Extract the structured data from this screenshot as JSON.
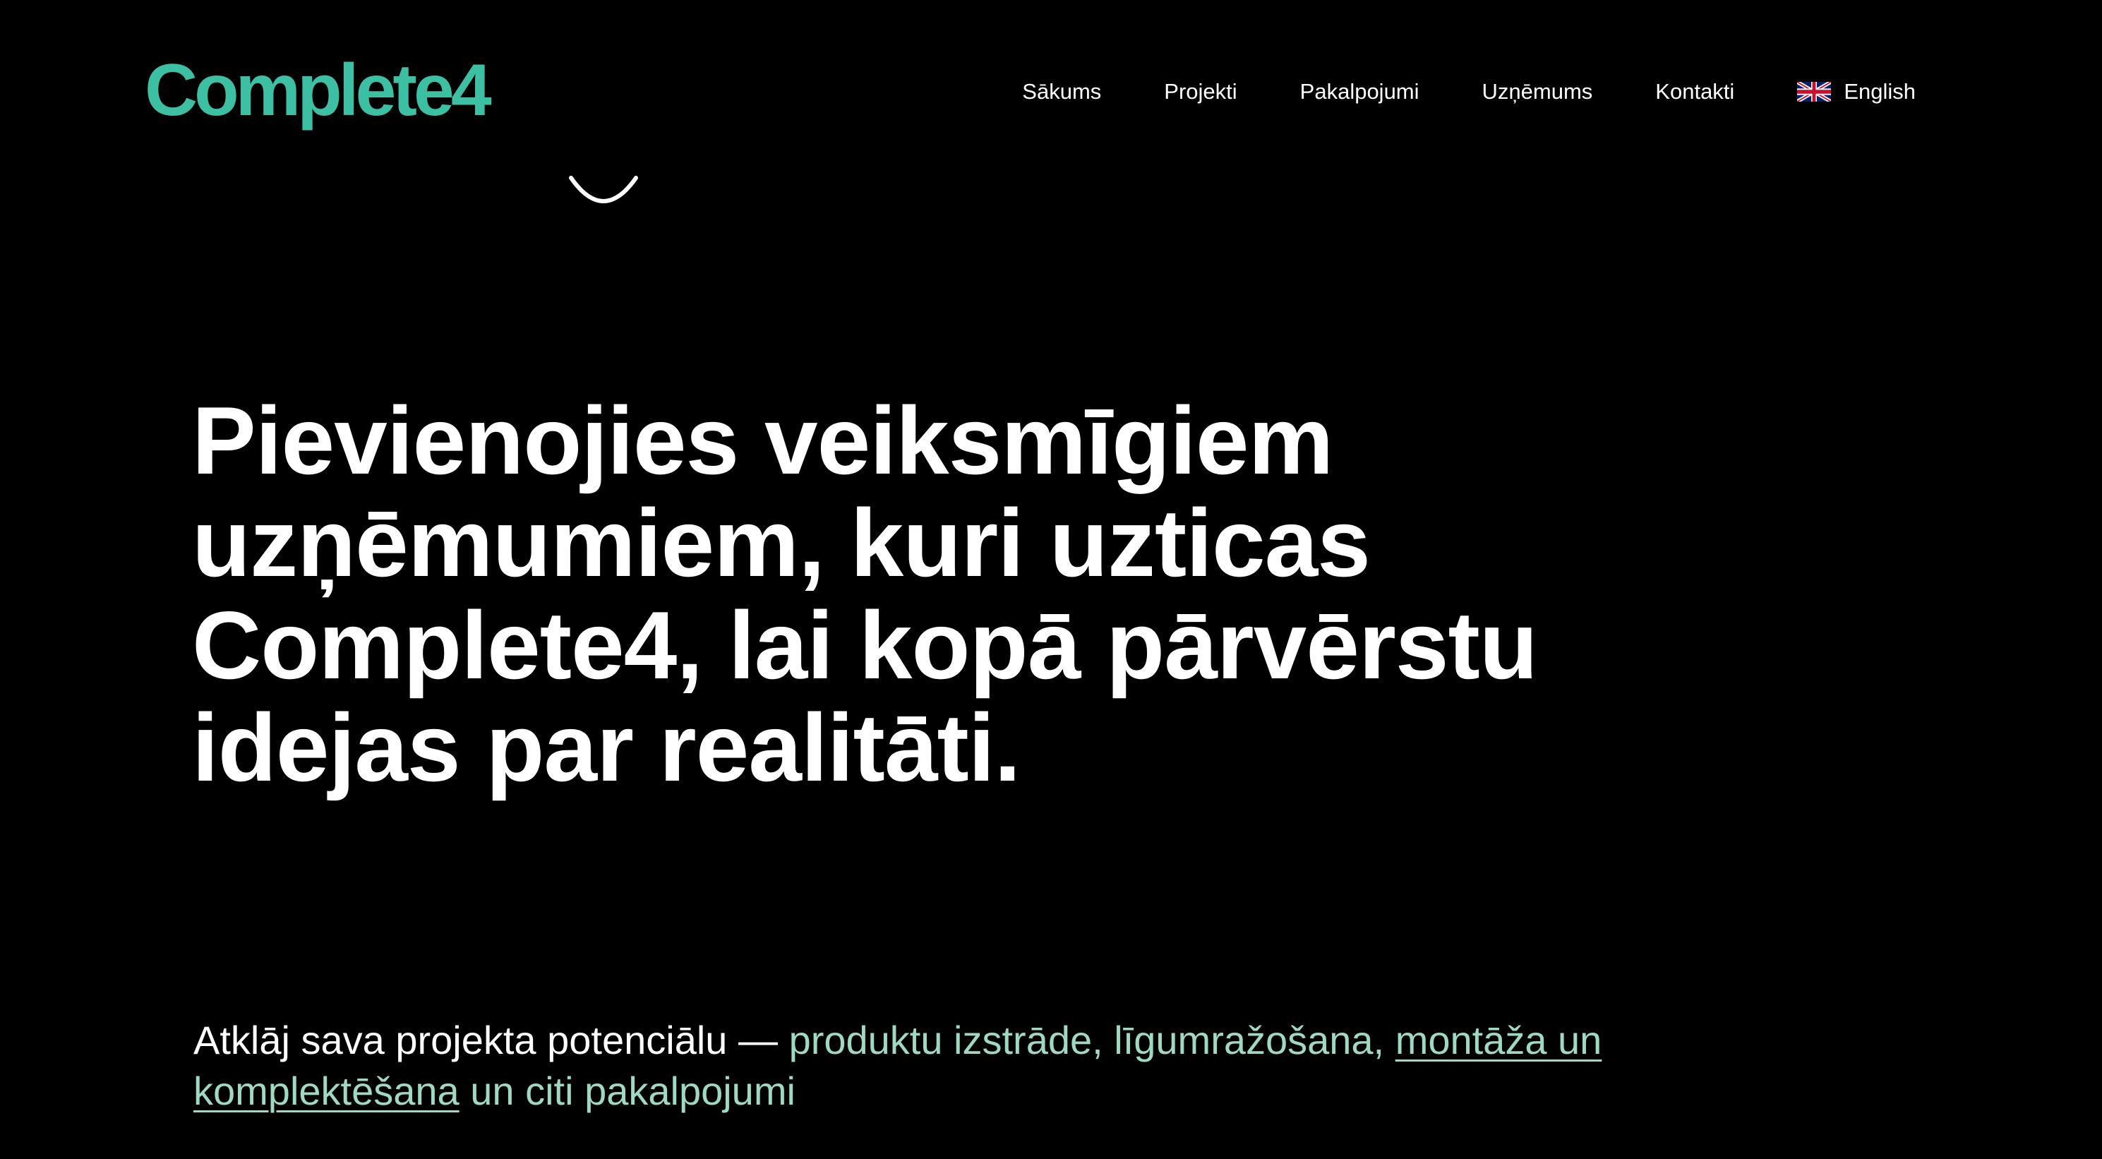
{
  "colors": {
    "background": "#000000",
    "brand_teal": "#3dbfa4",
    "accent_mint": "#9fd9c2",
    "text": "#ffffff"
  },
  "header": {
    "logo_text": "Complete4",
    "nav": [
      {
        "label": "Sākums"
      },
      {
        "label": "Projekti"
      },
      {
        "label": "Pakalpojumi"
      },
      {
        "label": "Uzņēmums"
      },
      {
        "label": "Kontakti"
      }
    ],
    "language": {
      "label": "English",
      "icon": "uk-flag-icon"
    }
  },
  "hero": {
    "title": "Pievienojies veiksmīgiem uzņēmumiem, kuri uzticas Complete4, lai kopā pārvērstu idejas par realitāti."
  },
  "tagline": {
    "intro": "Atklāj sava projekta potenciālu — ",
    "service_1": "produktu izstrāde, ",
    "service_2": "līgumražošana, ",
    "link_text": "montāža un komplektēšana",
    "outro": " un citi pakalpojumi"
  }
}
